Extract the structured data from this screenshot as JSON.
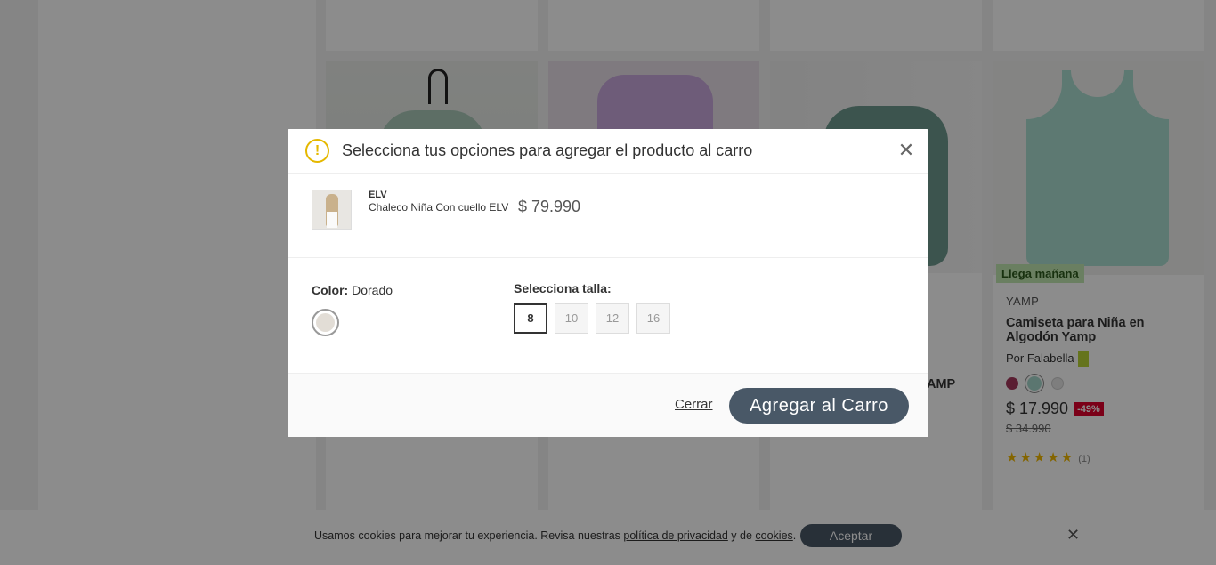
{
  "modal": {
    "title": "Selecciona tus opciones para agregar el producto al carro",
    "product": {
      "brand": "ELV",
      "name": "Chaleco Niña Con cuello ELV",
      "price": "$ 79.990"
    },
    "color": {
      "label": "Color:",
      "value": "Dorado",
      "swatch_color": "#e2ddd6"
    },
    "size": {
      "label": "Selecciona talla:",
      "options": [
        "8",
        "10",
        "12",
        "16"
      ],
      "selected": "8"
    },
    "close_label": "Cerrar",
    "add_to_cart_label": "Agregar al Carro",
    "close_icon": "close-icon",
    "warning_icon": "warning-icon"
  },
  "background_card": {
    "badge": "Llega mañana",
    "brand": "YAMP",
    "name": "Camiseta para Niña en Algodón Yamp",
    "seller": "Por Falabella",
    "price": "$ 17.990",
    "discount": "-49%",
    "old_price": "$ 34.990",
    "rating_count": "(1)",
    "partial_name": "AMP"
  },
  "cookie_bar": {
    "text_before": "Usamos cookies para mejorar tu experiencia. Revisa nuestras ",
    "privacy_link": "política de privacidad",
    "text_middle": " y de ",
    "cookies_link": "cookies",
    "text_after": ".",
    "accept_label": "Aceptar"
  },
  "colors": {
    "accent_button": "#495867",
    "warning": "#e5b800",
    "discount_badge": "#e1002d",
    "delivery_badge": "#c1e8b1"
  }
}
